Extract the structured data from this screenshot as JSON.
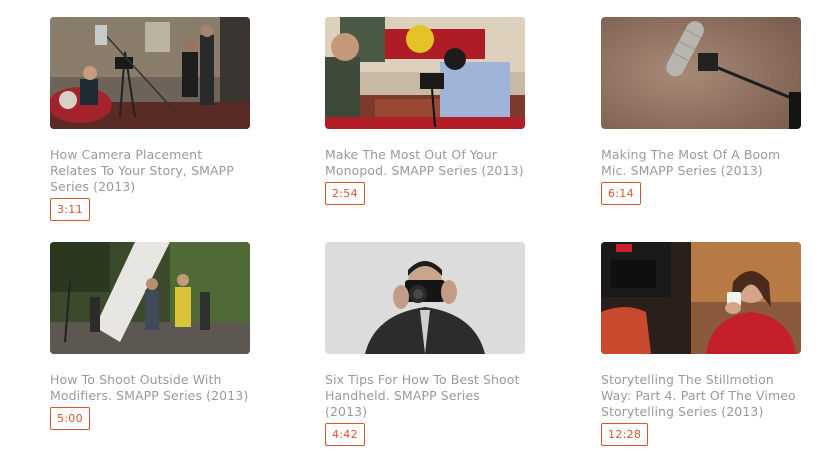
{
  "videos": [
    {
      "title": "How Camera Placement Relates To Your Story, SMAPP Series (2013)",
      "duration": "3:11",
      "thumbnail": "interview-camera-setup-thumbnail"
    },
    {
      "title": "Make The Most Out Of Your Monopod. SMAPP Series (2013)",
      "duration": "2:54",
      "thumbnail": "monopod-shooter-thumbnail"
    },
    {
      "title": "Making The Most Of A Boom Mic. SMAPP Series (2013)",
      "duration": "6:14",
      "thumbnail": "boom-mic-thumbnail"
    },
    {
      "title": "How To Shoot Outside With Modifiers. SMAPP Series (2013)",
      "duration": "5:00",
      "thumbnail": "outdoor-modifier-thumbnail"
    },
    {
      "title": "Six Tips For How To Best Shoot Handheld. SMAPP Series (2013)",
      "duration": "4:42",
      "thumbnail": "handheld-camera-thumbnail"
    },
    {
      "title": "Storytelling The Stillmotion Way: Part 4. Part Of The Vimeo Storytelling Series (2013)",
      "duration": "12:28",
      "thumbnail": "storytelling-coffee-thumbnail"
    }
  ],
  "colors": {
    "accent": "#d9542a",
    "title_text": "#9a9a9a"
  }
}
